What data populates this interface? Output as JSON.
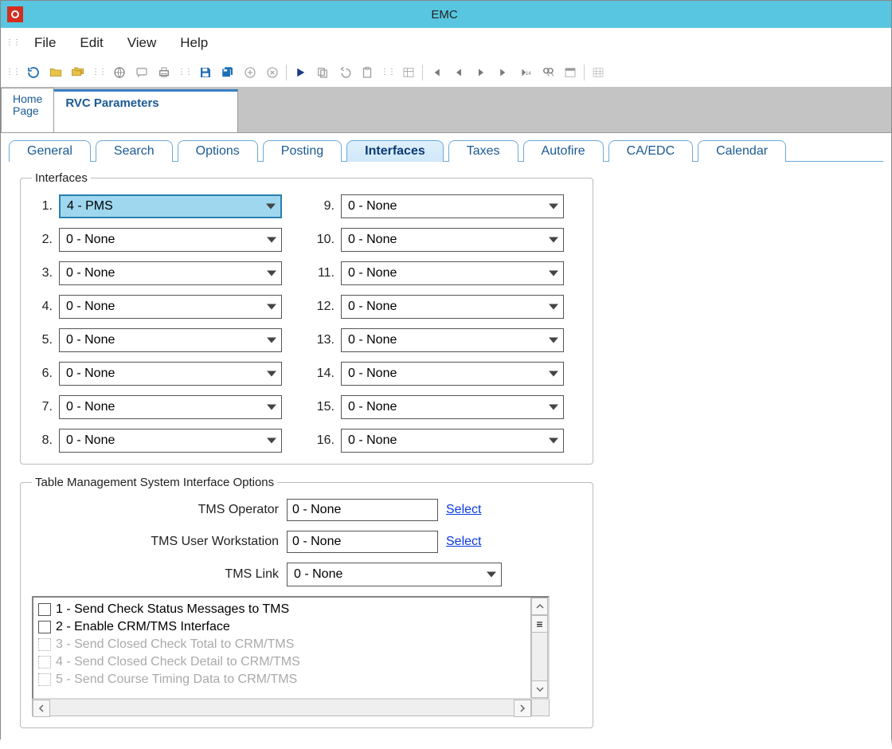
{
  "window": {
    "title": "EMC"
  },
  "menubar": [
    "File",
    "Edit",
    "View",
    "Help"
  ],
  "primary_tabs": {
    "home": "Home\nPage",
    "active": "RVC Parameters"
  },
  "secondary_tabs": [
    "General",
    "Search",
    "Options",
    "Posting",
    "Interfaces",
    "Taxes",
    "Autofire",
    "CA/EDC",
    "Calendar"
  ],
  "secondary_active": "Interfaces",
  "groups": {
    "interfaces_legend": "Interfaces",
    "tms_legend": "Table Management System Interface Options"
  },
  "interface_slots": [
    {
      "n": "1.",
      "v": "4 - PMS",
      "hl": true
    },
    {
      "n": "2.",
      "v": "0 - None"
    },
    {
      "n": "3.",
      "v": "0 - None"
    },
    {
      "n": "4.",
      "v": "0 - None"
    },
    {
      "n": "5.",
      "v": "0 - None"
    },
    {
      "n": "6.",
      "v": "0 - None"
    },
    {
      "n": "7.",
      "v": "0 - None"
    },
    {
      "n": "8.",
      "v": "0 - None"
    },
    {
      "n": "9.",
      "v": "0 - None"
    },
    {
      "n": "10.",
      "v": "0 - None"
    },
    {
      "n": "11.",
      "v": "0 - None"
    },
    {
      "n": "12.",
      "v": "0 - None"
    },
    {
      "n": "13.",
      "v": "0 - None"
    },
    {
      "n": "14.",
      "v": "0 - None"
    },
    {
      "n": "15.",
      "v": "0 - None"
    },
    {
      "n": "16.",
      "v": "0 - None"
    }
  ],
  "tms": {
    "operator_label": "TMS Operator",
    "operator_value": "0 - None",
    "operator_select": "Select",
    "workstation_label": "TMS User Workstation",
    "workstation_value": "0 - None",
    "workstation_select": "Select",
    "link_label": "TMS Link",
    "link_value": "0 - None"
  },
  "tms_options": [
    {
      "label": "1 - Send Check Status Messages to TMS",
      "disabled": false
    },
    {
      "label": "2 - Enable CRM/TMS Interface",
      "disabled": false
    },
    {
      "label": "3 - Send Closed Check Total to CRM/TMS",
      "disabled": true
    },
    {
      "label": "4 - Send Closed Check Detail to CRM/TMS",
      "disabled": true
    },
    {
      "label": "5 - Send Course Timing Data to CRM/TMS",
      "disabled": true
    }
  ]
}
